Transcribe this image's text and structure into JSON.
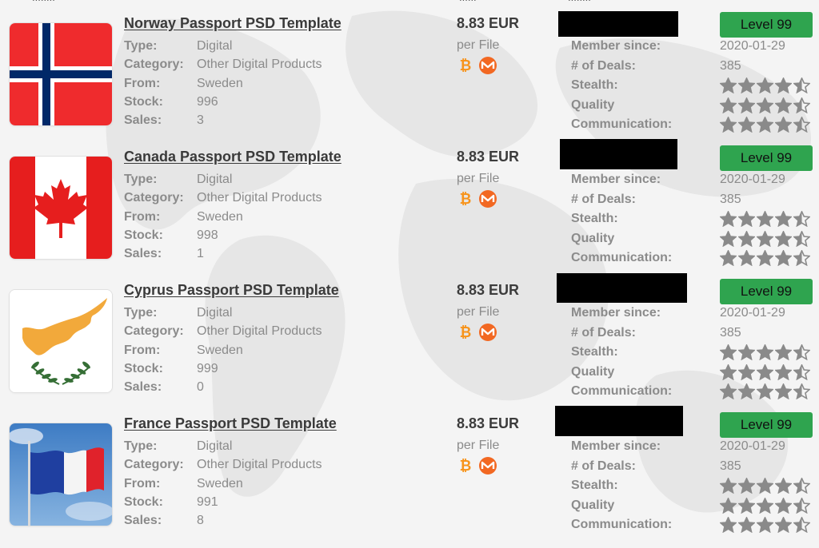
{
  "header_fragments": [
    "........",
    "......",
    "........"
  ],
  "listings": [
    {
      "title": "Norway Passport PSD Template",
      "flag_icon": "norway-flag-icon",
      "props": [
        {
          "key": "Type:",
          "value": "Digital"
        },
        {
          "key": "Category:",
          "value": "Other Digital Products"
        },
        {
          "key": "From:",
          "value": "Sweden"
        },
        {
          "key": "Stock:",
          "value": "996"
        },
        {
          "key": "Sales:",
          "value": "3"
        }
      ],
      "price": "8.83 EUR",
      "per_unit": "per File",
      "coins": [
        "bitcoin-icon",
        "monero-icon"
      ],
      "level": "Level 99",
      "vendor_labels": [
        "Member since:",
        "# of Deals:",
        "Stealth:",
        "Quality",
        "Communication:"
      ],
      "member_since": "2020-01-29",
      "deals": "385",
      "ratings": {
        "stealth": 4.5,
        "quality": 4.5,
        "communication": 4.5
      }
    },
    {
      "title": "Canada Passport PSD Template",
      "flag_icon": "canada-flag-icon",
      "props": [
        {
          "key": "Type:",
          "value": "Digital"
        },
        {
          "key": "Category:",
          "value": "Other Digital Products"
        },
        {
          "key": "From:",
          "value": "Sweden"
        },
        {
          "key": "Stock:",
          "value": "998"
        },
        {
          "key": "Sales:",
          "value": "1"
        }
      ],
      "price": "8.83 EUR",
      "per_unit": "per File",
      "coins": [
        "bitcoin-icon",
        "monero-icon"
      ],
      "level": "Level 99",
      "vendor_labels": [
        "Member since:",
        "# of Deals:",
        "Stealth:",
        "Quality",
        "Communication:"
      ],
      "member_since": "2020-01-29",
      "deals": "385",
      "ratings": {
        "stealth": 4.5,
        "quality": 4.5,
        "communication": 4.5
      }
    },
    {
      "title": "Cyprus Passport PSD Template",
      "flag_icon": "cyprus-flag-icon",
      "props": [
        {
          "key": "Type:",
          "value": "Digital"
        },
        {
          "key": "Category:",
          "value": "Other Digital Products"
        },
        {
          "key": "From:",
          "value": "Sweden"
        },
        {
          "key": "Stock:",
          "value": "999"
        },
        {
          "key": "Sales:",
          "value": "0"
        }
      ],
      "price": "8.83 EUR",
      "per_unit": "per File",
      "coins": [
        "bitcoin-icon",
        "monero-icon"
      ],
      "level": "Level 99",
      "vendor_labels": [
        "Member since:",
        "# of Deals:",
        "Stealth:",
        "Quality",
        "Communication:"
      ],
      "member_since": "2020-01-29",
      "deals": "385",
      "ratings": {
        "stealth": 4.5,
        "quality": 4.5,
        "communication": 4.5
      }
    },
    {
      "title": "France Passport PSD Template",
      "flag_icon": "france-flag-icon",
      "props": [
        {
          "key": "Type:",
          "value": "Digital"
        },
        {
          "key": "Category:",
          "value": "Other Digital Products"
        },
        {
          "key": "From:",
          "value": "Sweden"
        },
        {
          "key": "Stock:",
          "value": "991"
        },
        {
          "key": "Sales:",
          "value": "8"
        }
      ],
      "price": "8.83 EUR",
      "per_unit": "per File",
      "coins": [
        "bitcoin-icon",
        "monero-icon"
      ],
      "level": "Level 99",
      "vendor_labels": [
        "Member since:",
        "# of Deals:",
        "Stealth:",
        "Quality",
        "Communication:"
      ],
      "member_since": "2020-01-29",
      "deals": "385",
      "ratings": {
        "stealth": 4.5,
        "quality": 4.5,
        "communication": 4.5
      }
    }
  ],
  "colors": {
    "level_badge": "#2fa44f",
    "bitcoin": "#f7931a",
    "monero": "#f26822",
    "star": "#8a8a8a",
    "redaction": "#000000"
  }
}
